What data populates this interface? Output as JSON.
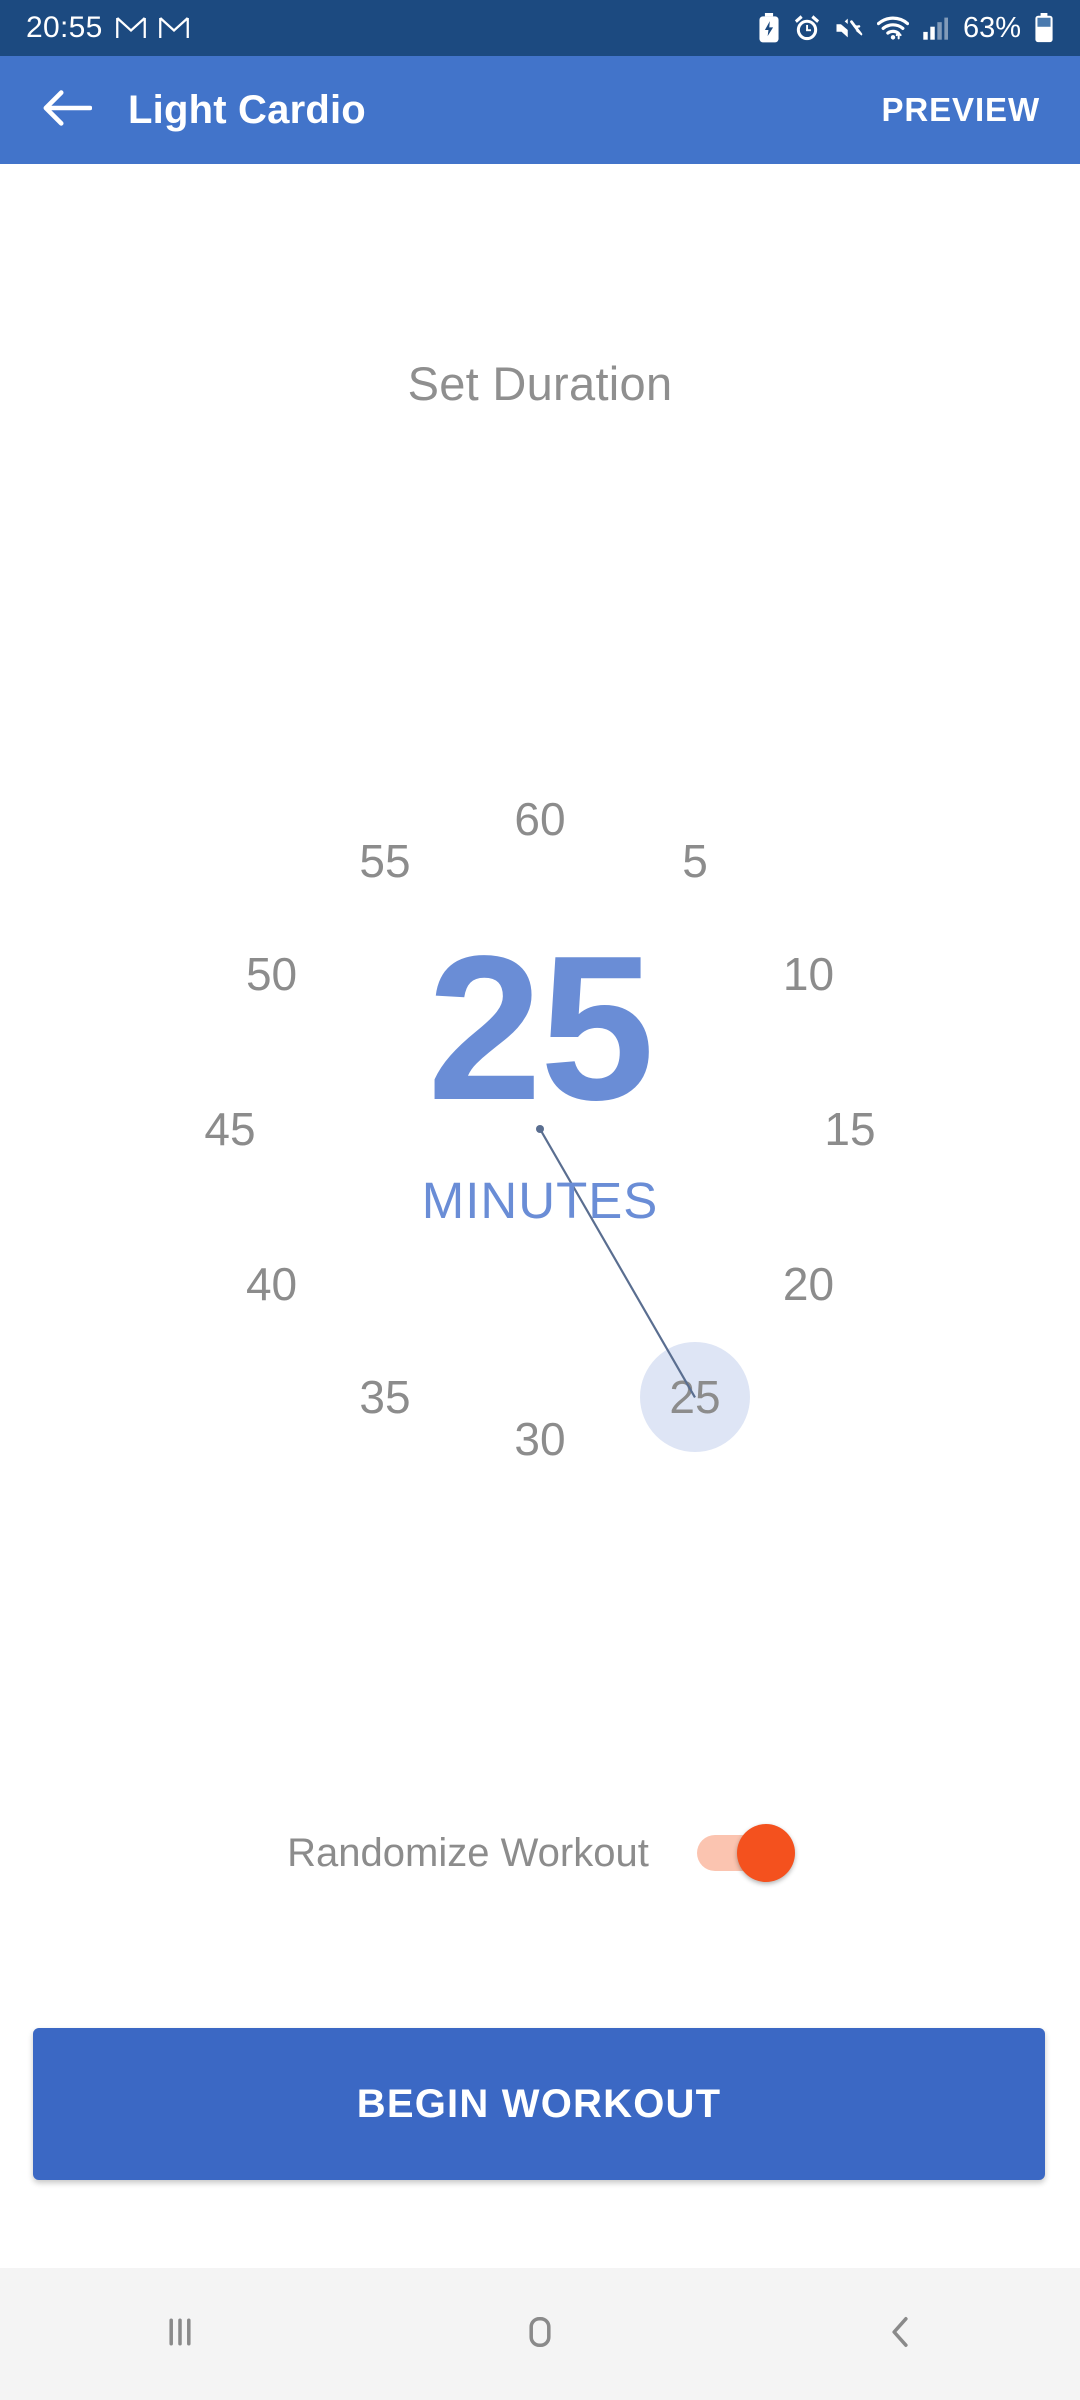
{
  "status_bar": {
    "time": "20:55",
    "battery_text": "63%",
    "left_icons": [
      "gmail-icon",
      "gmail-icon"
    ],
    "right_icons": [
      "battery-saver-icon",
      "alarm-icon",
      "sound-mute-icon",
      "wifi-icon",
      "cellular-signal-icon",
      "battery-icon"
    ],
    "background_color": "#1C4A80"
  },
  "app_bar": {
    "back_icon": "arrow-left-icon",
    "title": "Light Cardio",
    "preview_label": "PREVIEW",
    "background_color": "#4274CA"
  },
  "main": {
    "heading": "Set Duration",
    "picker": {
      "center_value": "25",
      "center_unit": "MINUTES",
      "selected_value": 25,
      "accent_color": "#6A8DD6",
      "selection_chip_color": "#DEE5F5",
      "tick_color": "#8C8C8C",
      "ticks": [
        {
          "label": "60",
          "angle": 0
        },
        {
          "label": "5",
          "angle": 30
        },
        {
          "label": "10",
          "angle": 60
        },
        {
          "label": "15",
          "angle": 90
        },
        {
          "label": "20",
          "angle": 120
        },
        {
          "label": "25",
          "angle": 150
        },
        {
          "label": "30",
          "angle": 180
        },
        {
          "label": "35",
          "angle": 210
        },
        {
          "label": "40",
          "angle": 240
        },
        {
          "label": "45",
          "angle": 270
        },
        {
          "label": "50",
          "angle": 300
        },
        {
          "label": "55",
          "angle": 330
        }
      ]
    },
    "randomize": {
      "label": "Randomize Workout",
      "enabled": true,
      "thumb_color": "#F4511E",
      "track_color": "#FBC4B0"
    },
    "begin_button": {
      "label": "BEGIN WORKOUT",
      "color": "#3B68C4"
    }
  },
  "nav_bar": {
    "recents_icon": "recents-icon",
    "home_icon": "home-icon",
    "back_icon": "back-chevron-icon",
    "background_color": "#F4F4F4"
  }
}
